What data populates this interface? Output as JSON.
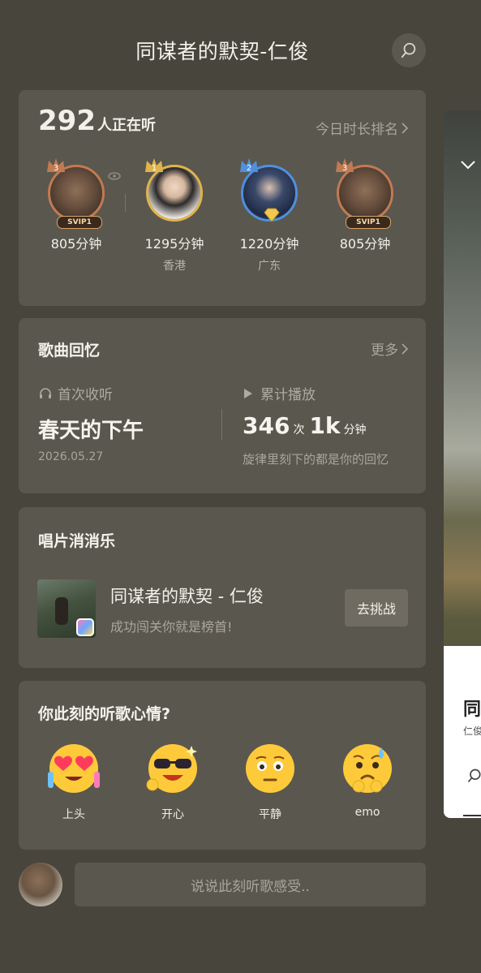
{
  "header": {
    "title": "同谋者的默契-仁俊",
    "search_icon": "search-icon"
  },
  "listeners": {
    "count": "292",
    "count_label": "人正在听",
    "ranking_link": "今日时长排名",
    "items": [
      {
        "rank": "3",
        "minutes": "805分钟",
        "region": "",
        "badge": "SVIP1",
        "avatar": "cat-photo"
      },
      {
        "rank": "1",
        "minutes": "1295分钟",
        "region": "香港",
        "badge": "",
        "avatar": "person-photo"
      },
      {
        "rank": "2",
        "minutes": "1220分钟",
        "region": "广东",
        "badge": "",
        "avatar": "person-photo"
      },
      {
        "rank": "3",
        "minutes": "805分钟",
        "region": "",
        "badge": "SVIP1",
        "avatar": "cat-photo"
      }
    ]
  },
  "memory": {
    "title": "歌曲回忆",
    "more": "更多",
    "first_listen_label": "首次收听",
    "first_listen_value": "春天的下午",
    "first_listen_date": "2026.05.27",
    "total_plays_label": "累计播放",
    "plays_count": "346",
    "plays_unit": "次",
    "minutes_count": "1k",
    "minutes_unit": "分钟",
    "plays_caption": "旋律里刻下的都是你的回忆"
  },
  "record_game": {
    "title": "唱片消消乐",
    "song": "同谋者的默契 - 仁俊",
    "subtitle": "成功闯关你就是榜首!",
    "button": "去挑战"
  },
  "mood": {
    "title": "你此刻的听歌心情?",
    "options": [
      {
        "label": "上头",
        "icon": "heart-eyes-emoji-icon"
      },
      {
        "label": "开心",
        "icon": "sunglasses-emoji-icon"
      },
      {
        "label": "平静",
        "icon": "calm-emoji-icon"
      },
      {
        "label": "emo",
        "icon": "sad-emoji-icon"
      }
    ]
  },
  "comment": {
    "placeholder": "说说此刻听歌感受.."
  },
  "colors": {
    "background": "#48453c",
    "card": "#5a574e",
    "accent_gold": "#d9a66a",
    "accent_blue": "#3d7fd6"
  }
}
